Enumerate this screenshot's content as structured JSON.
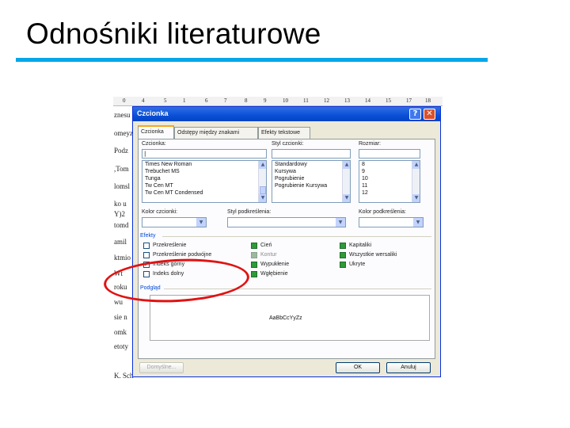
{
  "slide": {
    "title": "Odnośniki literaturowe"
  },
  "ruler": {
    "marks": [
      "0",
      "4",
      "5",
      "1",
      "6",
      "7",
      "8",
      "9",
      "10",
      "11",
      "12",
      "13",
      "14",
      "15",
      "17",
      "18"
    ]
  },
  "document": {
    "fragments": [
      "znesu",
      "omeyz",
      "Podz",
      ",Tom",
      "lomsl",
      "ko u",
      "Y)2",
      "tomd",
      "amil",
      "ktmio",
      "Wt",
      "roku",
      "wu",
      "sie n",
      "omk",
      "etoty",
      "K. Sch"
    ]
  },
  "dialog": {
    "title": "Czcionka",
    "help_glyph": "?",
    "close_glyph": "✕",
    "tabs": [
      "Czcionka",
      "Odstępy między znakami",
      "Efekty tekstowe"
    ],
    "font_label": "Czcionka:",
    "font_value": "|",
    "font_list": [
      "Times New Roman",
      "Trebuchet MS",
      "Tunga",
      "Tw Cen MT",
      "Tw Cen MT Condensed"
    ],
    "style_label": "Styl czcionki:",
    "style_value": "",
    "style_list": [
      "Standardowy",
      "Kursywa",
      "Pogrubienie",
      "Pogrubienie Kursywa"
    ],
    "size_label": "Rozmiar:",
    "size_value": "",
    "size_list": [
      "8",
      "9",
      "10",
      "11",
      "12"
    ],
    "font_color_label": "Kolor czcionki:",
    "underline_style_label": "Styl podkreślenia:",
    "underline_color_label": "Kolor podkreślenia:",
    "effects_label": "Efekty",
    "effects_col1": [
      {
        "label": "Przekreślenie",
        "checked": false
      },
      {
        "label": "Przekreślenie podwójne",
        "checked": false
      },
      {
        "label": "Indeks górny",
        "checked": true
      },
      {
        "label": "Indeks dolny",
        "checked": false
      }
    ],
    "effects_col2": [
      "Cień",
      "Kontur",
      "Wypukłenie",
      "Wgłębienie"
    ],
    "effects_col3": [
      "Kapitaliki",
      "Wszystkie wersaliki",
      "Ukryte"
    ],
    "preview_label": "Podgląd",
    "preview_text": "AaBbCcYyZz",
    "buttons": {
      "default": "Domyślne...",
      "ok": "OK",
      "cancel": "Anuluj"
    }
  },
  "annotation": {
    "color": "#e01313",
    "target": "Indeks górny"
  },
  "accent": "#00a8e8"
}
